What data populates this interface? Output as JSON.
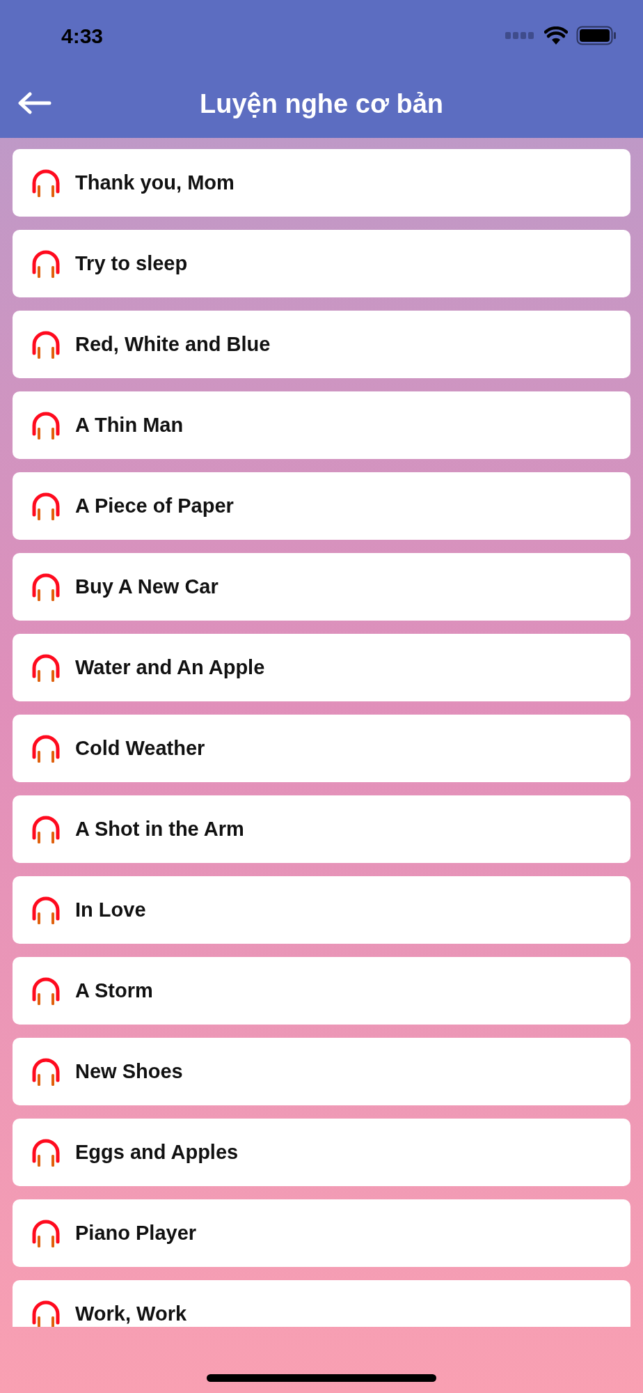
{
  "status_bar": {
    "time": "4:33"
  },
  "header": {
    "title": "Luyện nghe cơ bản"
  },
  "lessons": [
    {
      "title": "Thank you, Mom"
    },
    {
      "title": "Try to sleep"
    },
    {
      "title": "Red, White and Blue"
    },
    {
      "title": "A Thin Man"
    },
    {
      "title": "A Piece of Paper"
    },
    {
      "title": "Buy A New Car"
    },
    {
      "title": "Water and An Apple"
    },
    {
      "title": "Cold Weather"
    },
    {
      "title": "A Shot in the Arm"
    },
    {
      "title": "In Love"
    },
    {
      "title": "A Storm"
    },
    {
      "title": "New Shoes"
    },
    {
      "title": "Eggs and Apples"
    },
    {
      "title": "Piano Player"
    },
    {
      "title": "Work, Work"
    }
  ]
}
